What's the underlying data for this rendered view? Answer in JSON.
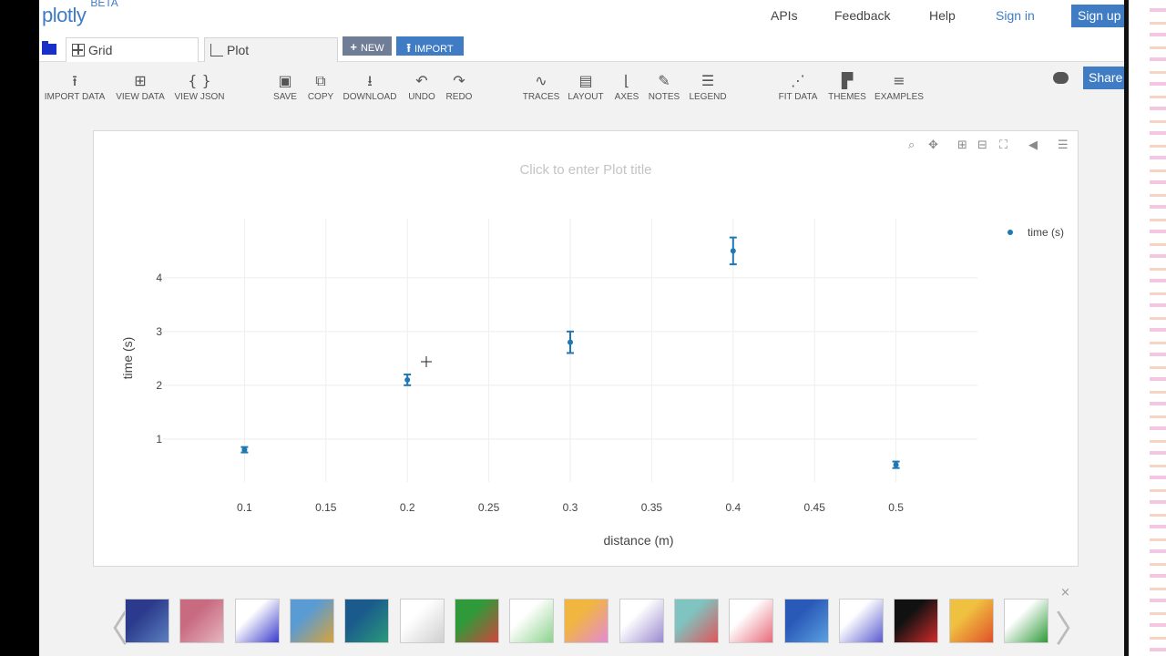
{
  "header": {
    "logo": "plotly",
    "logo_badge": "BETA",
    "nav": [
      "APIs",
      "Feedback",
      "Help"
    ],
    "sign_in": "Sign in",
    "sign_up": "Sign up"
  },
  "tabs": [
    {
      "label": "Grid",
      "icon": "grid-icon"
    },
    {
      "label": "Plot",
      "icon": "plot-icon"
    }
  ],
  "tab_buttons": [
    {
      "label": "NEW",
      "glyph": "+",
      "color": "#6f7d97"
    },
    {
      "label": "IMPORT",
      "glyph": "⭱",
      "color": "#3f7cc4"
    }
  ],
  "toolbar": [
    {
      "label": "IMPORT DATA",
      "icon": "upload-icon",
      "glyph": "⭱"
    },
    {
      "label": "VIEW DATA",
      "icon": "grid-icon",
      "glyph": "⊞"
    },
    {
      "label": "VIEW JSON",
      "icon": "braces-icon",
      "glyph": "{ }"
    },
    {
      "label": "SAVE",
      "icon": "save-icon",
      "glyph": "▣"
    },
    {
      "label": "COPY",
      "icon": "copy-icon",
      "glyph": "⧉"
    },
    {
      "label": "DOWNLOAD",
      "icon": "download-icon",
      "glyph": "⭳"
    },
    {
      "label": "UNDO",
      "icon": "undo-icon",
      "glyph": "↶"
    },
    {
      "label": "REDO",
      "icon": "redo-icon",
      "glyph": "↷"
    },
    {
      "label": "TRACES",
      "icon": "traces-icon",
      "glyph": "∿"
    },
    {
      "label": "LAYOUT",
      "icon": "layout-icon",
      "glyph": "▤"
    },
    {
      "label": "AXES",
      "icon": "axes-icon",
      "glyph": "⌊"
    },
    {
      "label": "NOTES",
      "icon": "pencil-icon",
      "glyph": "✎"
    },
    {
      "label": "LEGEND",
      "icon": "legend-icon",
      "glyph": "☰"
    },
    {
      "label": "FIT DATA",
      "icon": "fit-data-icon",
      "glyph": "⋰"
    },
    {
      "label": "THEMES",
      "icon": "paint-roller-icon",
      "glyph": "▛"
    },
    {
      "label": "EXAMPLES",
      "icon": "examples-icon",
      "glyph": "≡"
    }
  ],
  "share_label": "Share",
  "plot": {
    "title_placeholder": "Click to enter Plot title",
    "modebar": [
      "zoom-icon",
      "pan-icon",
      "zoom-in-icon",
      "zoom-out-icon",
      "autoscale-icon",
      "compare-hover-icon",
      "closest-hover-icon"
    ]
  },
  "chart_data": {
    "type": "scatter",
    "title": "",
    "xlabel": "distance (m)",
    "ylabel": "time (s)",
    "xlim": [
      0.05,
      0.55
    ],
    "ylim": [
      0.2,
      5.1
    ],
    "x_ticks": [
      "0.1",
      "0.15",
      "0.2",
      "0.25",
      "0.3",
      "0.35",
      "0.4",
      "0.45",
      "0.5"
    ],
    "y_ticks": [
      "1",
      "2",
      "3",
      "4"
    ],
    "grid": true,
    "legend_position": "top-right",
    "series": [
      {
        "name": "time (s)",
        "color": "#1f77b4",
        "x": [
          0.1,
          0.2,
          0.3,
          0.4,
          0.5
        ],
        "y": [
          0.8,
          2.1,
          2.8,
          4.5,
          0.52
        ],
        "error_y": [
          0.05,
          0.1,
          0.2,
          0.25,
          0.06
        ]
      }
    ]
  },
  "gallery": {
    "close": "×",
    "prev": "〈",
    "next": "〉",
    "thumbnails": [
      "area-chart",
      "box-plot",
      "histogram",
      "heatmap",
      "stacked-area",
      "polar",
      "wind-rose",
      "contour",
      "histogram-overlay",
      "scatter-fit",
      "bar-error",
      "bubble",
      "heatmap-dense",
      "line-marker",
      "multi-line",
      "heatmap-small",
      "scatter-fit-r2"
    ]
  }
}
